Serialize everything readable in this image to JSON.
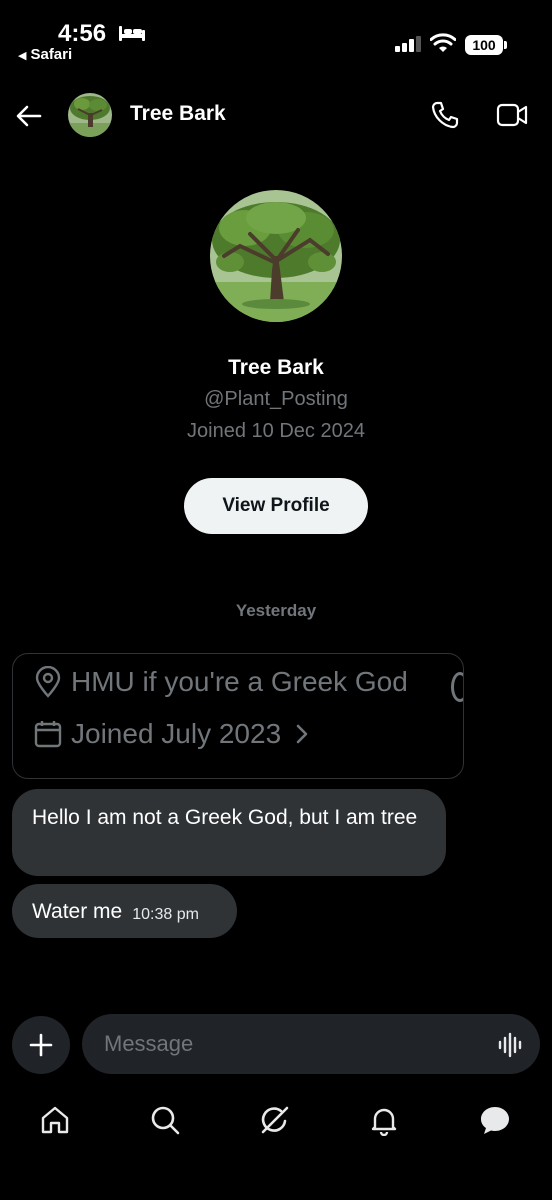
{
  "status_bar": {
    "time": "4:56",
    "back_app": "Safari",
    "battery": "100",
    "icons": [
      "bed-icon",
      "signal-icon",
      "wifi-icon",
      "battery-icon"
    ]
  },
  "header": {
    "name": "Tree Bark",
    "icons": [
      "back-arrow-icon",
      "avatar",
      "phone-icon",
      "video-icon"
    ]
  },
  "profile": {
    "name": "Tree Bark",
    "handle": "@Plant_Posting",
    "joined": "Joined 10 Dec 2024",
    "view_profile_label": "View Profile"
  },
  "conversation": {
    "date_separator": "Yesterday",
    "shared_card": {
      "location": "HMU if you're a Greek God",
      "joined": "Joined July 2023",
      "icons": [
        "location-pin-icon",
        "calendar-icon",
        "chevron-right-icon"
      ]
    },
    "messages": [
      {
        "text": "Hello I am not a Greek God, but I am tree"
      },
      {
        "text": "Water me",
        "time": "10:38 pm"
      }
    ]
  },
  "composer": {
    "placeholder": "Message",
    "icons": [
      "plus-icon",
      "voice-icon"
    ]
  },
  "bottom_nav": {
    "items": [
      "home-icon",
      "search-icon",
      "grok-icon",
      "notifications-icon",
      "messages-icon"
    ]
  },
  "colors": {
    "background": "#000000",
    "bubble": "#2f3336",
    "muted_text": "#71767b",
    "button_bg": "#eff3f4"
  }
}
